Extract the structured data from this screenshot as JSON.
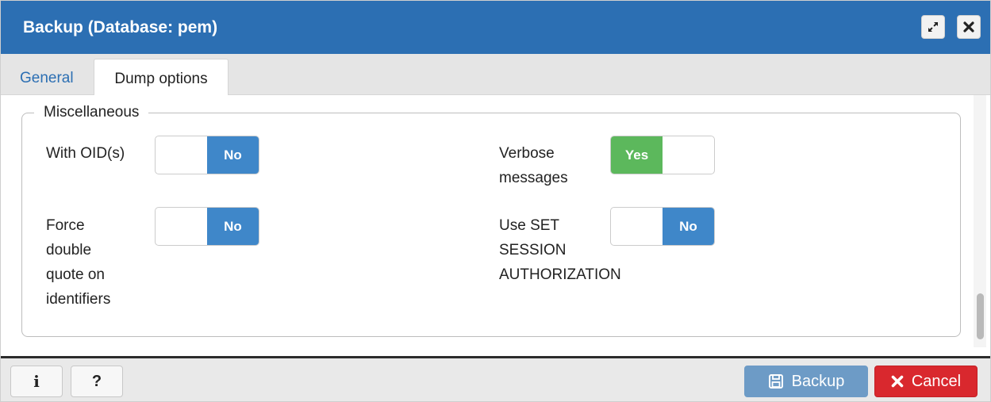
{
  "dialog": {
    "title": "Backup (Database: pem)"
  },
  "tabs": [
    {
      "label": "General",
      "active": false
    },
    {
      "label": "Dump options",
      "active": true
    }
  ],
  "misc": {
    "legend": "Miscellaneous",
    "fields": [
      {
        "label": "With OID(s)",
        "value": "No"
      },
      {
        "label": "Force double quote on identifiers",
        "value": "No"
      },
      {
        "label": "Verbose messages",
        "value": "Yes"
      },
      {
        "label": "Use SET SESSION AUTHORIZATION",
        "value": "No"
      }
    ]
  },
  "label_lines": {
    "with_oids": [
      "With OID(s)"
    ],
    "force_double_quote": [
      "Force",
      "double",
      "quote on",
      "identifiers"
    ],
    "verbose": [
      "Verbose",
      "messages"
    ],
    "use_set_session": [
      "Use SET",
      "SESSION",
      "AUTHORIZATION"
    ]
  },
  "footer": {
    "info_label": "i",
    "help_label": "?",
    "backup_label": "Backup",
    "cancel_label": "Cancel"
  },
  "colors": {
    "titlebar": "#2c6fb3",
    "toggle_no": "#3f87c9",
    "toggle_yes": "#5cb85c",
    "backup_button": "#6d9bc6",
    "cancel_button": "#d9282e"
  },
  "icons": {
    "expand": "expand-icon",
    "close": "close-icon",
    "backup": "floppy-disk-icon",
    "cancel": "x-icon"
  }
}
